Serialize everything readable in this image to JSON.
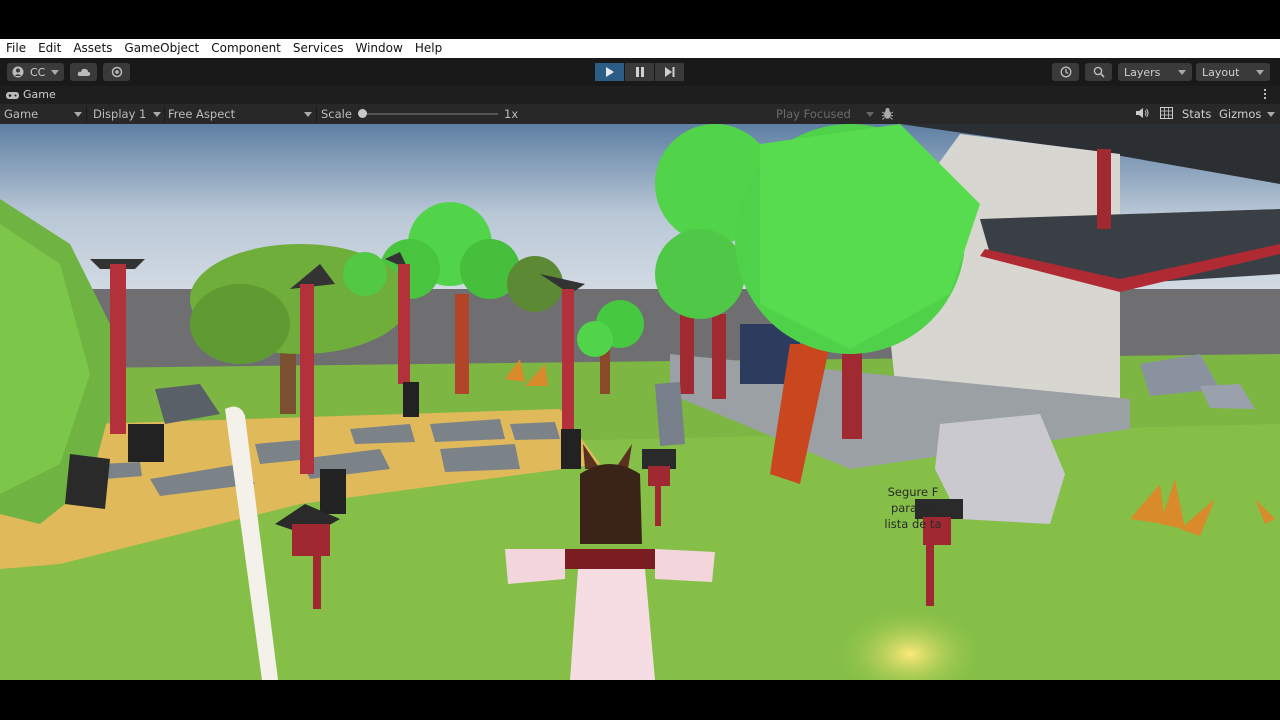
{
  "menu": [
    "File",
    "Edit",
    "Assets",
    "GameObject",
    "Component",
    "Services",
    "Window",
    "Help"
  ],
  "toolbar": {
    "account_label": "CC",
    "layers_label": "Layers",
    "layout_label": "Layout"
  },
  "game_tab": {
    "title": "Game"
  },
  "game_toolbar": {
    "view_label": "Game",
    "display_label": "Display 1",
    "aspect_label": "Free Aspect",
    "scale_label": "Scale",
    "scale_value": "1x",
    "play_focused_label": "Play Focused",
    "stats_label": "Stats",
    "gizmos_label": "Gizmos"
  },
  "game_hint": {
    "line1": "Segure F",
    "line2": "para ab",
    "line3": "lista de ta"
  },
  "icons": [
    "account-icon",
    "cloud-icon",
    "settings-icon",
    "play-icon",
    "pause-icon",
    "step-icon",
    "history-icon",
    "search-icon",
    "game-tab-icon",
    "more-icon",
    "bug-icon",
    "audio-icon",
    "grid-icon"
  ]
}
